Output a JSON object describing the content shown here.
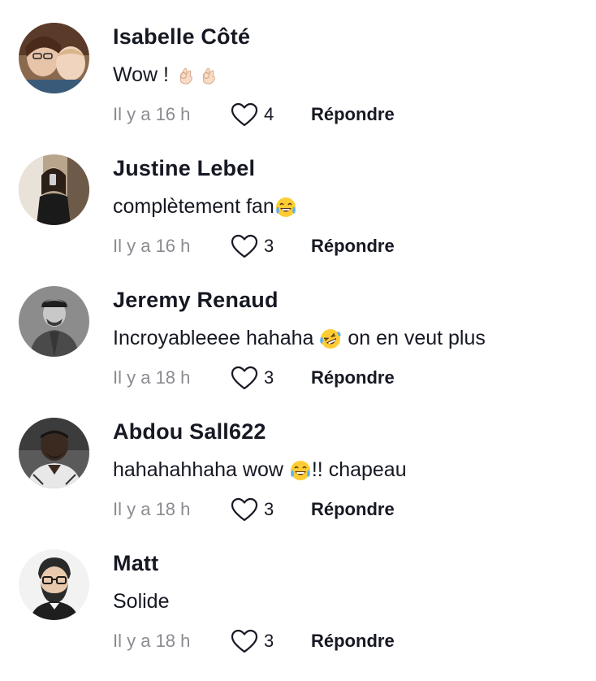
{
  "comments": [
    {
      "username": "Isabelle Côté",
      "text_before": "Wow ! ",
      "emoji": [
        "ok-hand-emoji",
        "ok-hand-emoji"
      ],
      "text_after": "",
      "time": "Il y a 16 h",
      "likes": "4",
      "reply_label": "Répondre"
    },
    {
      "username": "Justine Lebel",
      "text_before": "complètement fan",
      "emoji": [
        "laughing-tears-emoji"
      ],
      "text_after": "",
      "time": "Il y a 16 h",
      "likes": "3",
      "reply_label": "Répondre"
    },
    {
      "username": "Jeremy Renaud",
      "text_before": "Incroyableeee hahaha ",
      "emoji": [
        "rolling-laughing-emoji"
      ],
      "text_after": " on en veut plus",
      "time": "Il y a 18 h",
      "likes": "3",
      "reply_label": "Répondre"
    },
    {
      "username": "Abdou Sall622",
      "text_before": "hahahahhaha wow ",
      "emoji": [
        "laughing-tears-emoji"
      ],
      "text_after": "!! chapeau",
      "time": "Il y a 18 h",
      "likes": "3",
      "reply_label": "Répondre"
    },
    {
      "username": "Matt",
      "text_before": "Solide",
      "emoji": [],
      "text_after": "",
      "time": "Il y a 18 h",
      "likes": "3",
      "reply_label": "Répondre"
    }
  ],
  "colors": {
    "text_primary": "#161823",
    "text_secondary": "#8a8b91",
    "icon_stroke": "#161823"
  }
}
